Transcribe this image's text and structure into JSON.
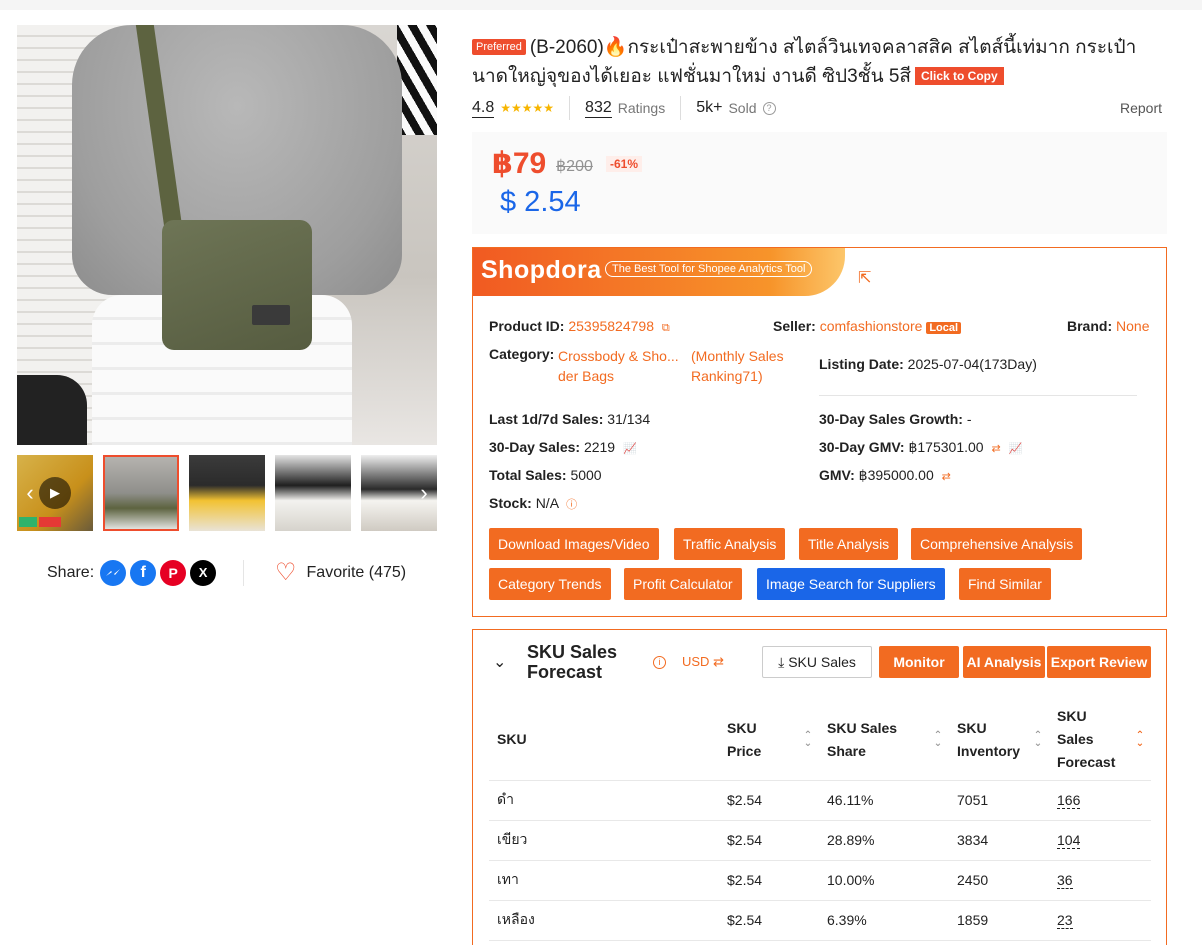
{
  "product": {
    "preferred_badge": "Preferred",
    "title": "(B-2060)🔥กระเป๋าสะพายข้าง สไตล์วินเทจคลาสสิค สไตส์นี้เท่มาก กระเป๋านาดใหญ่จุของได้เยอะ แฟชั่นมาใหม่ งานดี ซิป3ชั้น 5สี",
    "copy_button": "Click to Copy",
    "rating": "4.8",
    "stars": "★★★★★",
    "ratings_count": "832",
    "ratings_label": "Ratings",
    "sold_count": "5k+",
    "sold_label": "Sold",
    "report_label": "Report",
    "price": "฿79",
    "original_price": "฿200",
    "discount": "-61%",
    "price_usd": "$ 2.54"
  },
  "gallery": {
    "prev_icon": "‹",
    "next_icon": "›",
    "play_icon": "▶"
  },
  "share": {
    "label": "Share:",
    "favorite_label": "Favorite (475)"
  },
  "shopdora": {
    "logo": "Shopdora",
    "tagline": "The Best Tool for Shopee Analytics Tool",
    "product_id_label": "Product ID:",
    "product_id": "25395824798",
    "seller_label": "Seller:",
    "seller": "comfashionstore",
    "seller_tag": "Local",
    "brand_label": "Brand:",
    "brand": "None",
    "category_label": "Category:",
    "category_line1": "Crossbody & Sho...",
    "category_line2": "der Bags",
    "ranking_line1": "(Monthly Sales",
    "ranking_line2": "Ranking71)",
    "listing_date_label": "Listing Date:",
    "listing_date": "2025-07-04(173Day)",
    "sales_1d7d_label": "Last 1d/7d Sales:",
    "sales_1d7d": "31/134",
    "growth_label": "30-Day Sales Growth:",
    "growth": "-",
    "sales_30d_label": "30-Day Sales:",
    "sales_30d": "2219",
    "gmv_30d_label": "30-Day GMV:",
    "gmv_30d": "฿175301.00",
    "total_sales_label": "Total Sales:",
    "total_sales": "5000",
    "gmv_label": "GMV:",
    "gmv": "฿395000.00",
    "stock_label": "Stock:",
    "stock": "N/A",
    "buttons": [
      "Download Images/Video",
      "Traffic Analysis",
      "Title Analysis",
      "Comprehensive Analysis",
      "Category Trends",
      "Profit Calculator",
      "Image Search for Suppliers",
      "Find Similar"
    ]
  },
  "sku": {
    "title": "SKU Sales Forecast",
    "currency": "USD",
    "sku_sales_button": "SKU Sales",
    "monitor_button": "Monitor",
    "ai_button": "AI Analysis",
    "export_button": "Export Review",
    "columns": [
      "SKU",
      "SKU Price",
      "SKU Sales Share",
      "SKU Inventory",
      "SKU Sales Forecast"
    ],
    "rows": [
      {
        "sku": "ดำ",
        "price": "$2.54",
        "share": "46.11%",
        "inventory": "7051",
        "forecast": "166"
      },
      {
        "sku": "เขียว",
        "price": "$2.54",
        "share": "28.89%",
        "inventory": "3834",
        "forecast": "104"
      },
      {
        "sku": "เทา",
        "price": "$2.54",
        "share": "10.00%",
        "inventory": "2450",
        "forecast": "36"
      },
      {
        "sku": "เหลือง",
        "price": "$2.54",
        "share": "6.39%",
        "inventory": "1859",
        "forecast": "23"
      }
    ]
  },
  "colors": {
    "shopee_orange": "#ee4d2d",
    "shopdora_orange": "#f26b21",
    "usd_blue": "#1a66e8",
    "star_yellow": "#f7b500"
  }
}
